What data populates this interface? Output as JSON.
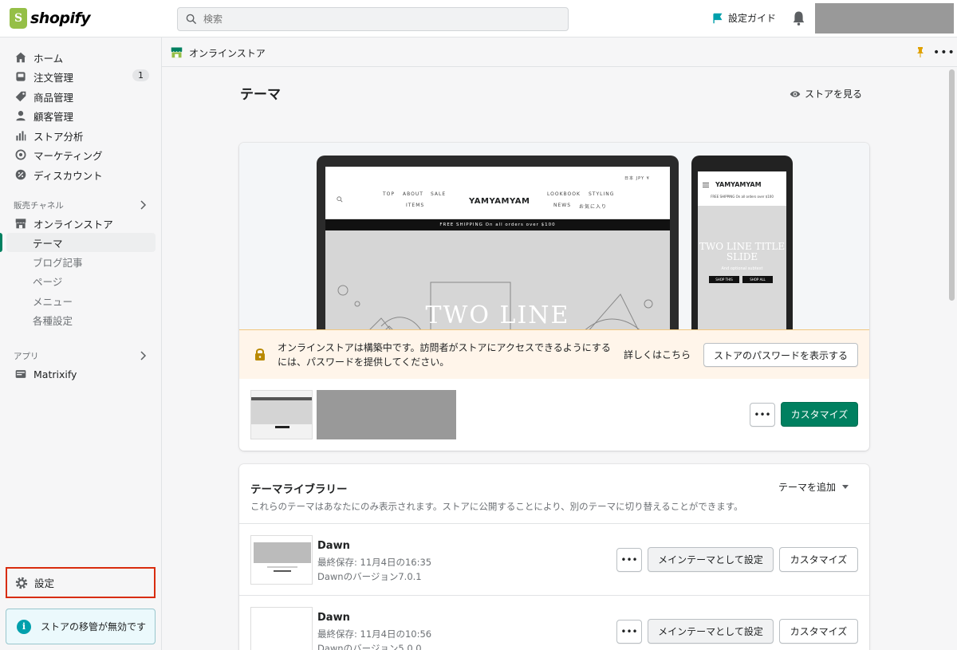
{
  "topbar": {
    "logo_text": "shopify",
    "search_placeholder": "検索",
    "setup_guide": "設定ガイド"
  },
  "sidebar": {
    "items": [
      {
        "label": "ホーム"
      },
      {
        "label": "注文管理",
        "badge": "1"
      },
      {
        "label": "商品管理"
      },
      {
        "label": "顧客管理"
      },
      {
        "label": "ストア分析"
      },
      {
        "label": "マーケティング"
      },
      {
        "label": "ディスカウント"
      }
    ],
    "sales_channels_title": "販売チャネル",
    "online_store": "オンラインストア",
    "online_store_sub": [
      "テーマ",
      "ブログ記事",
      "ページ",
      "メニュー",
      "各種設定"
    ],
    "apps_title": "アプリ",
    "apps": [
      "Matrixify"
    ],
    "settings": "設定",
    "transfer_notice": "ストアの移管が無効です"
  },
  "main": {
    "breadcrumb": "オンラインストア",
    "page_title": "テーマ",
    "view_store": "ストアを見る",
    "preview": {
      "nav_left": [
        "TOP",
        "ABOUT",
        "SALE",
        "ITEMS"
      ],
      "brand": "YAMYAMYAM",
      "nav_right": [
        "LOOKBOOK",
        "STYLING",
        "NEWS",
        "お気に入り"
      ],
      "lang": "日本 JPY ¥",
      "shipping": "FREE SHIPPING On all orders over $100",
      "hero_text": "TWO LINE",
      "mobile_hero_text": "TWO LINE TITLE SLIDE",
      "mobile_subtitle": "And optional subtext",
      "mobile_btn1": "SHOP THIS",
      "mobile_btn2": "SHOP ALL"
    },
    "notice": {
      "text": "オンラインストアは構築中です。訪問者がストアにアクセスできるようにするには、パスワードを提供してください。",
      "learn_more": "詳しくはこちら",
      "show_password": "ストアのパスワードを表示する"
    },
    "current_theme": {
      "more": "•••",
      "customize": "カスタマイズ"
    },
    "library": {
      "title": "テーマライブラリー",
      "add_theme": "テーマを追加",
      "description": "これらのテーマはあなたにのみ表示されます。ストアに公開することにより、別のテーマに切り替えることができます。",
      "themes": [
        {
          "name": "Dawn",
          "saved": "最終保存: 11月4日の16:35",
          "version": "Dawnのバージョン7.0.1"
        },
        {
          "name": "Dawn",
          "saved": "最終保存: 11月4日の10:56",
          "version": "Dawnのバージョン5.0.0"
        }
      ],
      "more": "•••",
      "publish": "メインテーマとして設定",
      "customize": "カスタマイズ"
    }
  },
  "colors": {
    "primary": "#008060",
    "highlight_border": "#d82c0d",
    "notice_bg": "#fff5ea"
  }
}
